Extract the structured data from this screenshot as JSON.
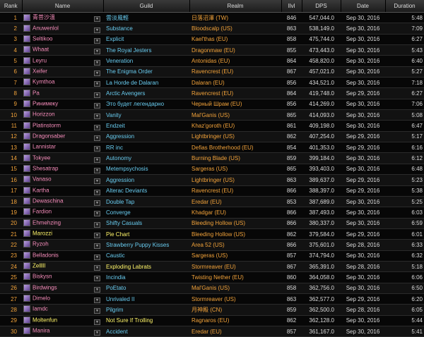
{
  "columns": [
    "Rank",
    "Name",
    "Guild",
    "Realm",
    "Ilvl",
    "DPS",
    "Date",
    "Duration"
  ],
  "class_colors": {
    "warlock": "#9482c9",
    "mage": "#69ccf0",
    "rogue": "#fff569",
    "paladin": "#f58cba"
  },
  "rows": [
    {
      "rank": "1",
      "name": "青菩沙溫",
      "guild": "雲淡風輕",
      "realm": "日落沼澤 (TW)",
      "ilvl": "846",
      "dps": "547,044.0",
      "date": "Sep 30, 2016",
      "duration": "5:48",
      "color": "#f58cba",
      "icon": "warlock-class-icon"
    },
    {
      "rank": "2",
      "name": "Anuwenlol",
      "guild": "Substance",
      "realm": "Bloodscalp (US)",
      "ilvl": "863",
      "dps": "538,149.0",
      "date": "Sep 30, 2016",
      "duration": "7:09",
      "color": "#f58cba",
      "icon": "warlock-class-icon"
    },
    {
      "rank": "3",
      "name": "Seltikoo",
      "guild": "Explicit",
      "realm": "Kael'thas (EU)",
      "ilvl": "858",
      "dps": "475,744.0",
      "date": "Sep 30, 2016",
      "duration": "6:27",
      "color": "#f58cba",
      "icon": "warlock-class-icon"
    },
    {
      "rank": "4",
      "name": "Whaat",
      "guild": "The Royal Jesters",
      "realm": "Dragonmaw (EU)",
      "ilvl": "855",
      "dps": "473,443.0",
      "date": "Sep 30, 2016",
      "duration": "5:43",
      "color": "#f58cba",
      "icon": "warlock-class-icon"
    },
    {
      "rank": "5",
      "name": "Leyru",
      "guild": "Veneration",
      "realm": "Antonidas (EU)",
      "ilvl": "864",
      "dps": "458,820.0",
      "date": "Sep 30, 2016",
      "duration": "6:40",
      "color": "#f58cba",
      "icon": "warlock-class-icon"
    },
    {
      "rank": "6",
      "name": "Xeifer",
      "guild": "The Enigma Order",
      "realm": "Ravencrest (EU)",
      "ilvl": "867",
      "dps": "457,021.0",
      "date": "Sep 30, 2016",
      "duration": "5:27",
      "color": "#f58cba",
      "icon": "warlock-class-icon"
    },
    {
      "rank": "7",
      "name": "Kymthoa",
      "guild": "La Horde de Dalaran",
      "realm": "Dalaran (EU)",
      "ilvl": "856",
      "dps": "434,521.0",
      "date": "Sep 30, 2016",
      "duration": "7:18",
      "color": "#f58cba",
      "icon": "warlock-class-icon"
    },
    {
      "rank": "8",
      "name": "Pa",
      "guild": "Arctic Avengers",
      "realm": "Ravencrest (EU)",
      "ilvl": "864",
      "dps": "419,748.0",
      "date": "Sep 29, 2016",
      "duration": "6:27",
      "color": "#f58cba",
      "icon": "warlock-class-icon"
    },
    {
      "rank": "9",
      "name": "Ринимеку",
      "guild": "Это будет легендарно",
      "realm": "Черный Шрам (EU)",
      "ilvl": "856",
      "dps": "414,269.0",
      "date": "Sep 30, 2016",
      "duration": "7:06",
      "color": "#f58cba",
      "icon": "warlock-class-icon"
    },
    {
      "rank": "10",
      "name": "Horizzon",
      "guild": "Vanity",
      "realm": "Mal'Ganis (US)",
      "ilvl": "865",
      "dps": "414,093.0",
      "date": "Sep 30, 2016",
      "duration": "5:08",
      "color": "#f58cba",
      "icon": "warlock-class-icon"
    },
    {
      "rank": "11",
      "name": "Platinstorm",
      "guild": "Endzeit",
      "realm": "Khaz'goroth (EU)",
      "ilvl": "861",
      "dps": "409,198.0",
      "date": "Sep 30, 2016",
      "duration": "6:47",
      "color": "#f58cba",
      "icon": "warlock-class-icon"
    },
    {
      "rank": "12",
      "name": "Dragonsaber",
      "guild": "Aggression",
      "realm": "Lightbringer (US)",
      "ilvl": "862",
      "dps": "407,254.0",
      "date": "Sep 29, 2016",
      "duration": "5:17",
      "color": "#f58cba",
      "icon": "warlock-class-icon"
    },
    {
      "rank": "13",
      "name": "Lannistar",
      "guild": "RR inc",
      "realm": "Defias Brotherhood (EU)",
      "ilvl": "854",
      "dps": "401,353.0",
      "date": "Sep 29, 2016",
      "duration": "6:16",
      "color": "#f58cba",
      "icon": "warlock-class-icon"
    },
    {
      "rank": "14",
      "name": "Tokyee",
      "guild": "Autonomy",
      "realm": "Burning Blade (US)",
      "ilvl": "859",
      "dps": "399,184.0",
      "date": "Sep 30, 2016",
      "duration": "6:12",
      "color": "#f58cba",
      "icon": "warlock-class-icon"
    },
    {
      "rank": "15",
      "name": "Shesatrap",
      "guild": "Metempsychosis",
      "realm": "Sargeras (US)",
      "ilvl": "865",
      "dps": "393,403.0",
      "date": "Sep 30, 2016",
      "duration": "6:48",
      "color": "#f58cba",
      "icon": "warlock-class-icon"
    },
    {
      "rank": "16",
      "name": "Vanaso",
      "guild": "Aggression",
      "realm": "Lightbringer (US)",
      "ilvl": "863",
      "dps": "389,637.0",
      "date": "Sep 29, 2016",
      "duration": "5:23",
      "color": "#f58cba",
      "icon": "warlock-class-icon"
    },
    {
      "rank": "17",
      "name": "Kartha",
      "guild": "Alterac Deviants",
      "realm": "Ravencrest (EU)",
      "ilvl": "866",
      "dps": "388,397.0",
      "date": "Sep 29, 2016",
      "duration": "5:38",
      "color": "#f58cba",
      "icon": "warlock-class-icon"
    },
    {
      "rank": "18",
      "name": "Dewaschina",
      "guild": "Double Tap",
      "realm": "Eredar (EU)",
      "ilvl": "853",
      "dps": "387,689.0",
      "date": "Sep 30, 2016",
      "duration": "5:25",
      "color": "#f58cba",
      "icon": "warlock-class-icon"
    },
    {
      "rank": "19",
      "name": "Fardion",
      "guild": "Converge",
      "realm": "Khadgar (EU)",
      "ilvl": "866",
      "dps": "387,493.0",
      "date": "Sep 30, 2016",
      "duration": "6:03",
      "color": "#f58cba",
      "icon": "warlock-class-icon"
    },
    {
      "rank": "20",
      "name": "Ehmehzing",
      "guild": "Shifty Casuals",
      "realm": "Bleeding Hollow (US)",
      "ilvl": "866",
      "dps": "380,337.0",
      "date": "Sep 30, 2016",
      "duration": "6:59",
      "color": "#f58cba",
      "icon": "warlock-class-icon"
    },
    {
      "rank": "21",
      "name": "Marozzi",
      "guild": "Pie Chart",
      "realm": "Bleeding Hollow (US)",
      "ilvl": "862",
      "dps": "379,584.0",
      "date": "Sep 29, 2016",
      "duration": "6:01",
      "color": "#fff569",
      "icon": "rogue-class-icon"
    },
    {
      "rank": "22",
      "name": "Ryzoh",
      "guild": "Strawberry Puppy Kisses",
      "realm": "Area 52 (US)",
      "ilvl": "866",
      "dps": "375,601.0",
      "date": "Sep 28, 2016",
      "duration": "6:33",
      "color": "#f58cba",
      "icon": "warlock-class-icon"
    },
    {
      "rank": "23",
      "name": "Belladonis",
      "guild": "Caustic",
      "realm": "Sargeras (US)",
      "ilvl": "857",
      "dps": "374,794.0",
      "date": "Sep 30, 2016",
      "duration": "6:32",
      "color": "#f58cba",
      "icon": "warlock-class-icon"
    },
    {
      "rank": "24",
      "name": "Zelllll",
      "guild": "Exploding Labrats",
      "realm": "Stormreaver (EU)",
      "ilvl": "867",
      "dps": "365,391.0",
      "date": "Sep 28, 2016",
      "duration": "5:18",
      "color": "#fff569",
      "icon": "rogue-class-icon"
    },
    {
      "rank": "25",
      "name": "Biskysn",
      "guild": "Incindia",
      "realm": "Twisting Nether (EU)",
      "ilvl": "860",
      "dps": "364,058.0",
      "date": "Sep 30, 2016",
      "duration": "6:06",
      "color": "#f58cba",
      "icon": "warlock-class-icon"
    },
    {
      "rank": "26",
      "name": "Birdwings",
      "guild": "PoEtato",
      "realm": "Mal'Ganis (US)",
      "ilvl": "858",
      "dps": "362,756.0",
      "date": "Sep 30, 2016",
      "duration": "6:50",
      "color": "#f58cba",
      "icon": "warlock-class-icon"
    },
    {
      "rank": "27",
      "name": "Dimelo",
      "guild": "Unrivaled II",
      "realm": "Stormreaver (US)",
      "ilvl": "863",
      "dps": "362,577.0",
      "date": "Sep 29, 2016",
      "duration": "6:20",
      "color": "#f58cba",
      "icon": "warlock-class-icon"
    },
    {
      "rank": "28",
      "name": "Iamdc",
      "guild": "Pilgrim",
      "realm": "月神殿 (CN)",
      "ilvl": "859",
      "dps": "362,500.0",
      "date": "Sep 28, 2016",
      "duration": "6:05",
      "color": "#f58cba",
      "icon": "warlock-class-icon"
    },
    {
      "rank": "29",
      "name": "Moltenfun",
      "guild": "Not Sure If Trolling",
      "realm": "Ragnaros (EU)",
      "ilvl": "862",
      "dps": "362,128.0",
      "date": "Sep 30, 2016",
      "duration": "5:44",
      "color": "#fff569",
      "icon": "rogue-class-icon"
    },
    {
      "rank": "30",
      "name": "Manira",
      "guild": "Accident",
      "realm": "Eredar (EU)",
      "ilvl": "857",
      "dps": "361,167.0",
      "date": "Sep 30, 2016",
      "duration": "5:41",
      "color": "#f58cba",
      "icon": "warlock-class-icon"
    }
  ]
}
